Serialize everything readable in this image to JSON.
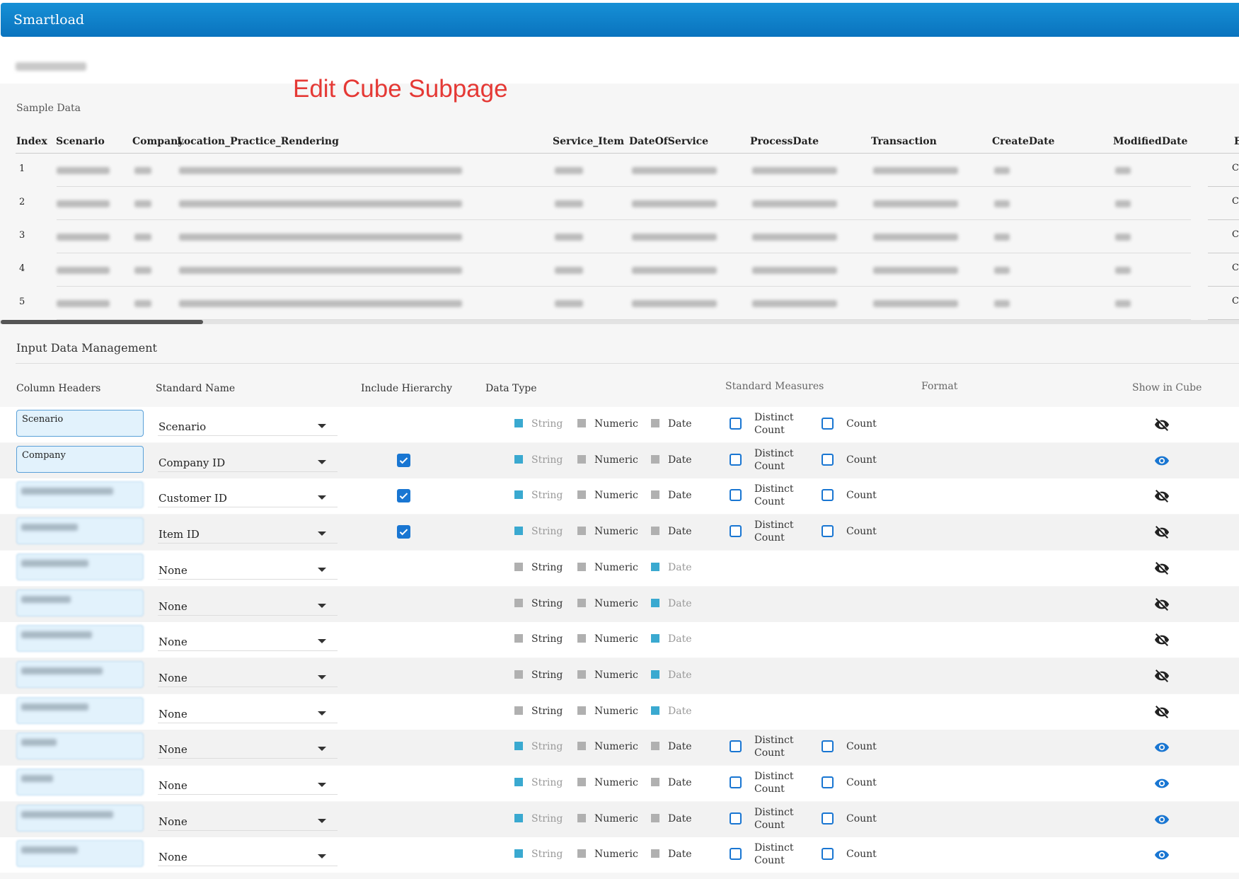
{
  "app": {
    "title": "Smartload"
  },
  "annotation": "Edit Cube Subpage",
  "sample_data": {
    "title": "Sample Data",
    "columns": [
      "Index",
      "Scenario",
      "Company",
      "Location_Practice_Rendering",
      "Service_Item",
      "DateOfService",
      "ProcessDate",
      "Transaction",
      "CreateDate",
      "ModifiedDate",
      "E"
    ],
    "rows": [
      {
        "index": "1",
        "cut": "C"
      },
      {
        "index": "2",
        "cut": "C"
      },
      {
        "index": "3",
        "cut": "C"
      },
      {
        "index": "4",
        "cut": "C"
      },
      {
        "index": "5",
        "cut": "C"
      }
    ]
  },
  "idm": {
    "title": "Input Data Management",
    "headers": {
      "column_headers": "Column Headers",
      "standard_name": "Standard Name",
      "include_hierarchy": "Include Hierarchy",
      "data_type": "Data Type",
      "standard_measures": "Standard Measures",
      "format": "Format",
      "show_in_cube": "Show in Cube"
    },
    "labels": {
      "string": "String",
      "numeric": "Numeric",
      "date": "Date",
      "distinct": "Distinct",
      "count_word": "Count",
      "count": "Count"
    },
    "rows": [
      {
        "header": "Scenario",
        "standard": "Scenario",
        "hierarchy": false,
        "type": "string",
        "measures": true,
        "show": false
      },
      {
        "header": "Company",
        "standard": "Company ID",
        "hierarchy": true,
        "type": "string",
        "measures": true,
        "show": true
      },
      {
        "header": "",
        "standard": "Customer ID",
        "hierarchy": true,
        "type": "string",
        "measures": true,
        "show": false
      },
      {
        "header": "",
        "standard": "Item ID",
        "hierarchy": true,
        "type": "string",
        "measures": true,
        "show": false
      },
      {
        "header": "",
        "standard": "None",
        "hierarchy": false,
        "type": "date",
        "measures": false,
        "show": false
      },
      {
        "header": "",
        "standard": "None",
        "hierarchy": false,
        "type": "date",
        "measures": false,
        "show": false
      },
      {
        "header": "",
        "standard": "None",
        "hierarchy": false,
        "type": "date",
        "measures": false,
        "show": false
      },
      {
        "header": "",
        "standard": "None",
        "hierarchy": false,
        "type": "date",
        "measures": false,
        "show": false
      },
      {
        "header": "",
        "standard": "None",
        "hierarchy": false,
        "type": "date",
        "measures": false,
        "show": false
      },
      {
        "header": "",
        "standard": "None",
        "hierarchy": false,
        "type": "string",
        "measures": true,
        "show": true
      },
      {
        "header": "",
        "standard": "None",
        "hierarchy": false,
        "type": "string",
        "measures": true,
        "show": true
      },
      {
        "header": "",
        "standard": "None",
        "hierarchy": false,
        "type": "string",
        "measures": true,
        "show": true
      },
      {
        "header": "",
        "standard": "None",
        "hierarchy": false,
        "type": "string",
        "measures": true,
        "show": true
      }
    ]
  },
  "colors": {
    "accent": "#1976d2",
    "topbar": "#0a73be",
    "selected_type": "#3aa9d0"
  }
}
